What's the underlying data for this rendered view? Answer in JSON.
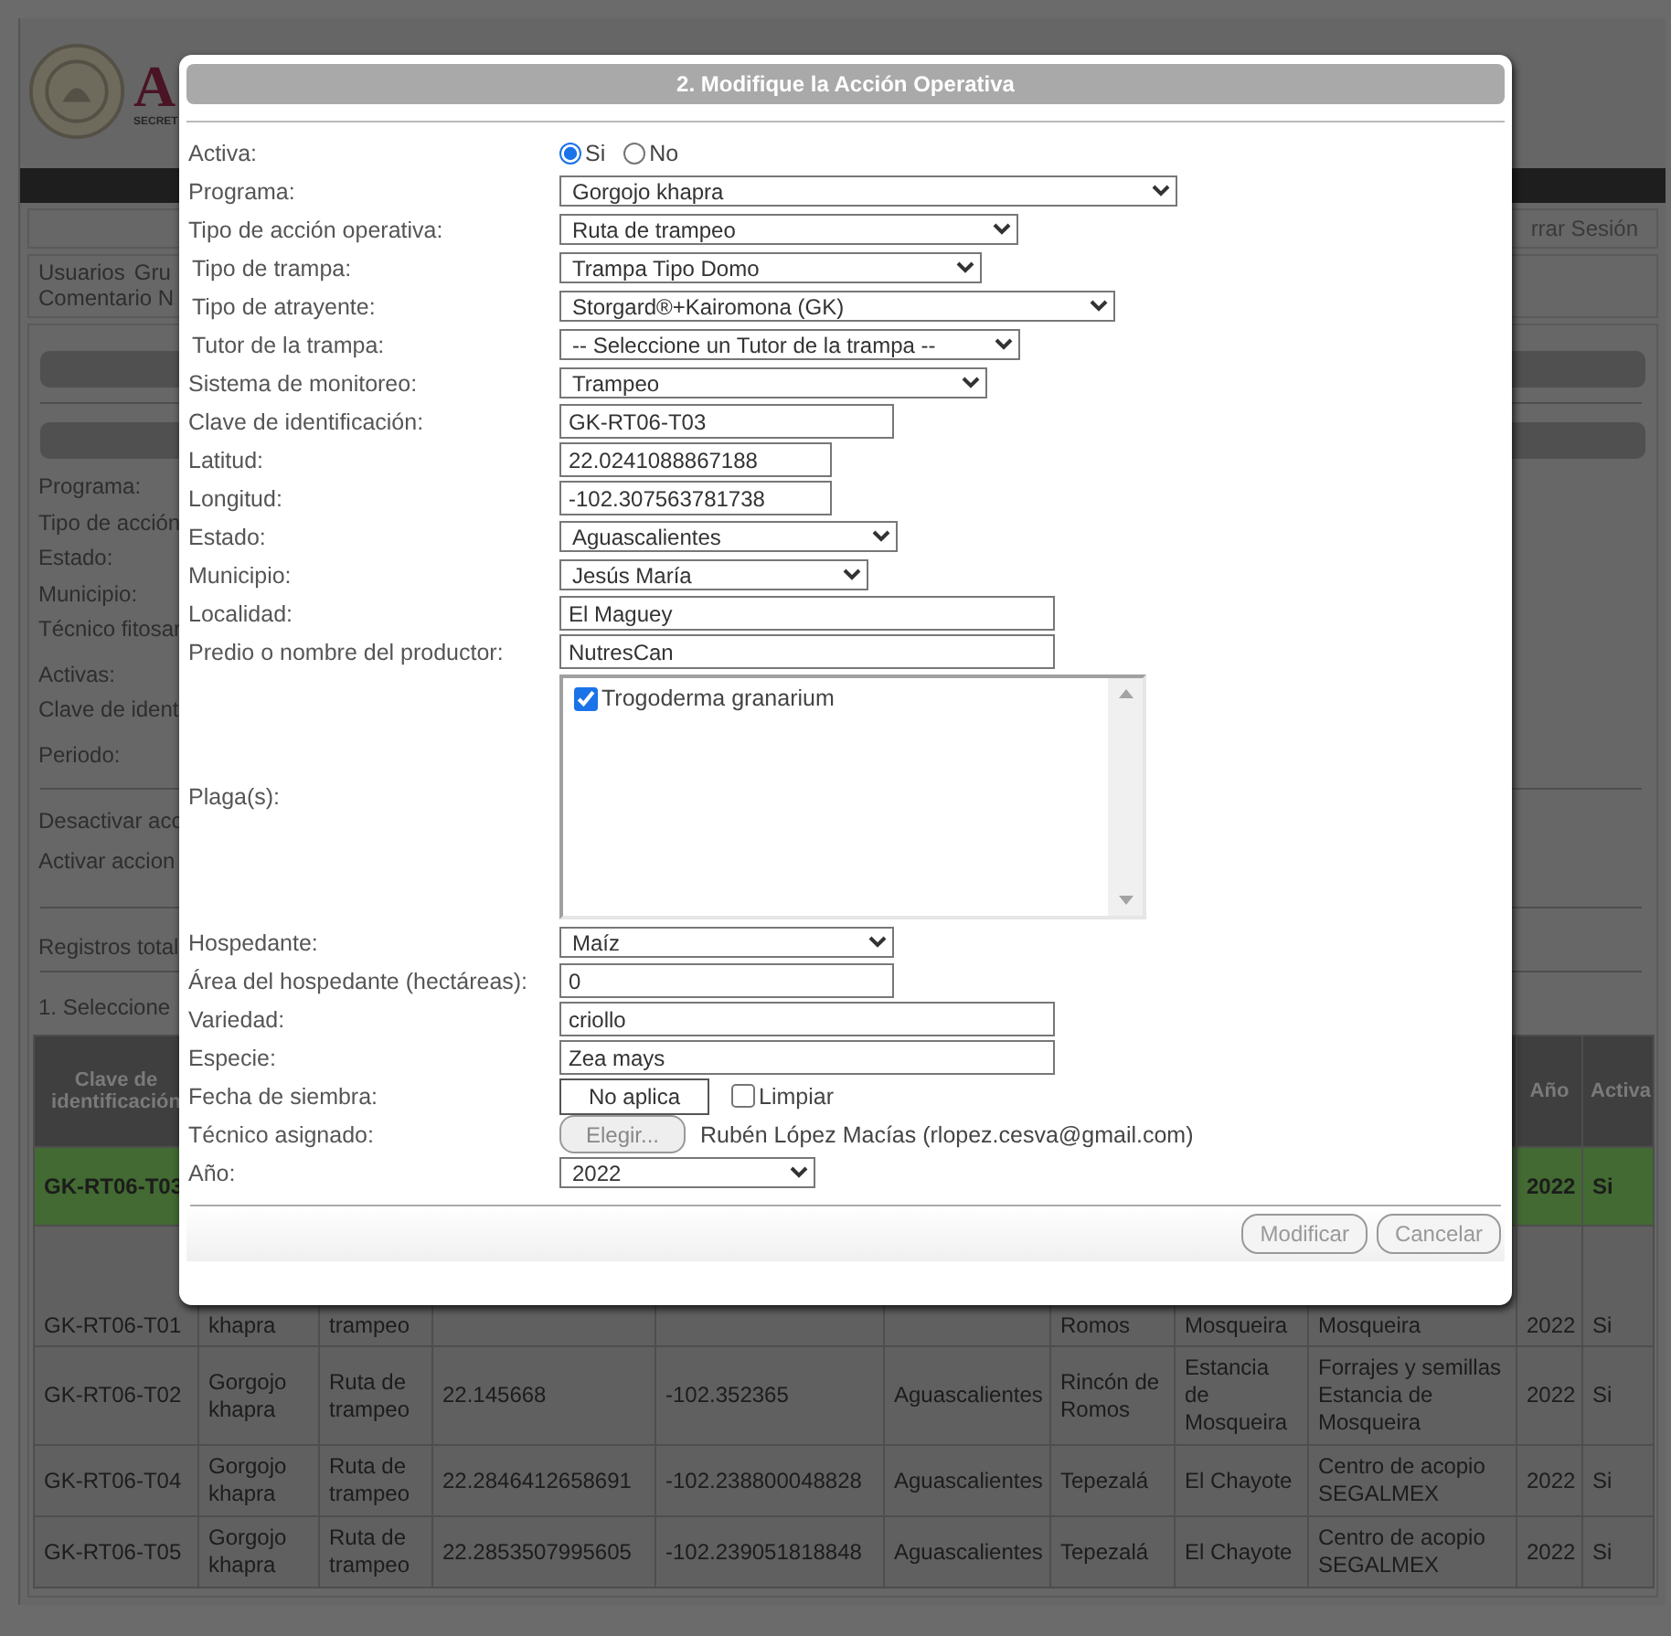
{
  "header": {
    "logo_text": "A",
    "logo_subtext": "SECRET",
    "session_link": "rrar Sesión"
  },
  "nav": {
    "links": [
      "Usuarios",
      "Gru"
    ],
    "comment_link": "Comentario N"
  },
  "filters": {
    "labels": [
      "Programa:",
      "Tipo de acción",
      "Estado:",
      "Municipio:",
      "Técnico fitosar",
      "Activas:",
      "Clave de ident",
      "Periodo:"
    ],
    "actions": [
      "Desactivar acc",
      "Activar accion"
    ],
    "total": "Registros total",
    "step": "1. Seleccione"
  },
  "table": {
    "columns": [
      "Clave de identificación",
      null,
      null,
      null,
      null,
      null,
      null,
      null,
      null,
      "Año",
      "Activa"
    ],
    "rows": [
      {
        "selected": true,
        "cells": [
          "GK-RT06-T03",
          null,
          null,
          null,
          null,
          null,
          null,
          null,
          null,
          "2022",
          "Si"
        ]
      },
      {
        "selected": false,
        "cells": [
          "GK-RT06-T01",
          "khapra",
          "trampeo",
          null,
          null,
          null,
          "Romos",
          "Mosqueira",
          "Mosqueira",
          "2022",
          "Si"
        ]
      },
      {
        "selected": false,
        "cells": [
          "GK-RT06-T02",
          "Gorgojo khapra",
          "Ruta de trampeo",
          "22.145668",
          "-102.352365",
          "Aguascalientes",
          "Rincón de Romos",
          "Estancia de Mosqueira",
          "Forrajes y semillas Estancia de Mosqueira",
          "2022",
          "Si"
        ]
      },
      {
        "selected": false,
        "cells": [
          "GK-RT06-T04",
          "Gorgojo khapra",
          "Ruta de trampeo",
          "22.2846412658691",
          "-102.238800048828",
          "Aguascalientes",
          "Tepezalá",
          "El Chayote",
          "Centro de acopio SEGALMEX",
          "2022",
          "Si"
        ]
      },
      {
        "selected": false,
        "cells": [
          "GK-RT06-T05",
          "Gorgojo khapra",
          "Ruta de trampeo",
          "22.2853507995605",
          "-102.239051818848",
          "Aguascalientes",
          "Tepezalá",
          "El Chayote",
          "Centro de acopio SEGALMEX",
          "2022",
          "Si"
        ]
      }
    ]
  },
  "dialog": {
    "title": "2. Modifique la Acción Operativa",
    "fields": [
      {
        "kind": "radio",
        "label": "Activa:",
        "options": [
          {
            "label": "Si",
            "selected": true
          },
          {
            "label": "No",
            "selected": false
          }
        ]
      },
      {
        "kind": "select",
        "label": "Programa:",
        "value": "Gorgojo khapra"
      },
      {
        "kind": "select",
        "label": "Tipo de acción operativa:",
        "value": "Ruta de trampeo"
      },
      {
        "kind": "select",
        "label": "Tipo de trampa:",
        "value": "Trampa Tipo Domo"
      },
      {
        "kind": "select",
        "label": "Tipo de atrayente:",
        "value": "Storgard®+Kairomona (GK)"
      },
      {
        "kind": "select",
        "label": "Tutor de la trampa:",
        "value": "-- Seleccione un Tutor de la trampa --"
      },
      {
        "kind": "select",
        "label": "Sistema de monitoreo:",
        "value": "Trampeo"
      },
      {
        "kind": "text",
        "label": "Clave de identificación:",
        "value": "GK-RT06-T03"
      },
      {
        "kind": "text",
        "label": "Latitud:",
        "value": "22.0241088867188"
      },
      {
        "kind": "text",
        "label": "Longitud:",
        "value": "-102.307563781738"
      },
      {
        "kind": "select",
        "label": "Estado:",
        "value": "Aguascalientes"
      },
      {
        "kind": "select",
        "label": "Municipio:",
        "value": "Jesús María"
      },
      {
        "kind": "text",
        "label": "Localidad:",
        "value": "El Maguey"
      },
      {
        "kind": "text",
        "label": "Predio o nombre del productor:",
        "value": "NutresCan"
      },
      {
        "kind": "listbox",
        "label": "Plaga(s):",
        "items": [
          {
            "label": "Trogoderma granarium",
            "checked": true
          }
        ]
      },
      {
        "kind": "select",
        "label": "Hospedante:",
        "value": "Maíz"
      },
      {
        "kind": "text",
        "label": "Área del hospedante (hectáreas):",
        "value": "0"
      },
      {
        "kind": "text",
        "label": "Variedad:",
        "value": "criollo"
      },
      {
        "kind": "text",
        "label": "Especie:",
        "value": "Zea mays"
      },
      {
        "kind": "date",
        "label": "Fecha de siembra:",
        "value": "No aplica",
        "clear_label": "Limpiar",
        "clear_checked": false
      },
      {
        "kind": "picker",
        "label": "Técnico asignado:",
        "button": "Elegir...",
        "button_disabled": true,
        "value": "Rubén López Macías (rlopez.cesva@gmail.com)"
      },
      {
        "kind": "select",
        "label": "Año:",
        "value": "2022"
      }
    ],
    "buttons": [
      {
        "label": "Modificar",
        "disabled": true
      },
      {
        "label": "Cancelar",
        "disabled": true
      }
    ]
  }
}
